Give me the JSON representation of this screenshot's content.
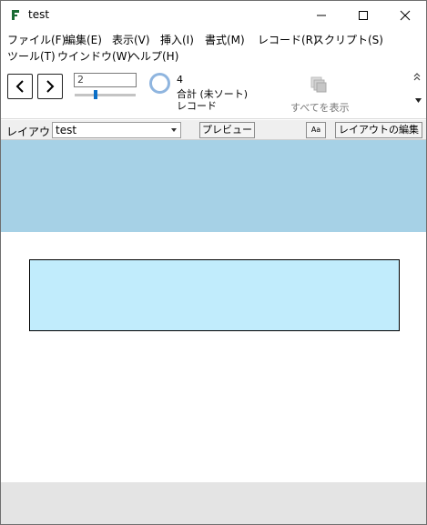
{
  "window": {
    "title": "test",
    "icon": "app-icon"
  },
  "menubar": {
    "items": [
      {
        "label": "ファイル(F)"
      },
      {
        "label": "編集(E)"
      },
      {
        "label": "表示(V)"
      },
      {
        "label": "挿入(I)"
      },
      {
        "label": "書式(M)"
      },
      {
        "label": "レコード(R)"
      },
      {
        "label": "スクリプト(S)"
      },
      {
        "label": "ツール(T)"
      },
      {
        "label": "ウインドウ(W)"
      },
      {
        "label": "ヘルプ(H)"
      }
    ]
  },
  "statusbar": {
    "current_record": "2",
    "record_count": "4",
    "total_label": "合計 (未ソート)",
    "records_label": "レコード",
    "show_all_label": "すべてを表示",
    "collapse_icon": "chevron-double-up-icon",
    "slider_position": 0.35
  },
  "layoutbar": {
    "layout_label": "レイアウト:",
    "layout_value": "test",
    "preview_label": "プレビュー",
    "text_format_label": "Aa",
    "edit_layout_label": "レイアウトの編集"
  },
  "colors": {
    "header_part": "#a6d1e6",
    "field": "#c1ecfc",
    "footer_part": "#e4e4e4"
  }
}
